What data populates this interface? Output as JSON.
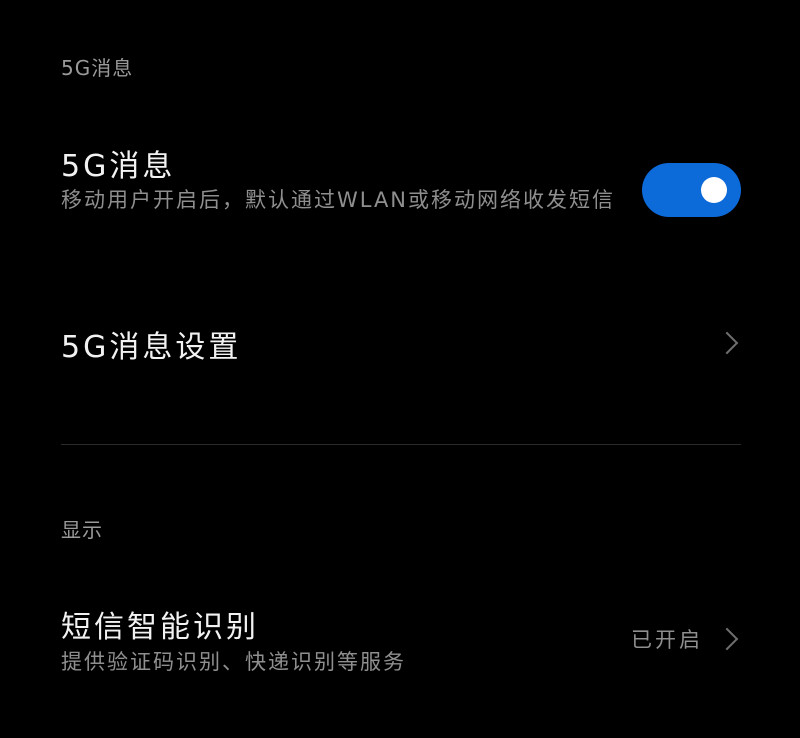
{
  "colors": {
    "background": "#000000",
    "accent": "#0d6ad9",
    "text_primary": "#f2f2f2",
    "text_secondary": "#8f8f8f"
  },
  "sections": [
    {
      "header": "5G消息",
      "items": [
        {
          "title": "5G消息",
          "description": "移动用户开启后，默认通过WLAN或移动网络收发短信",
          "control": "toggle",
          "toggle_on": true
        },
        {
          "title": "5G消息设置",
          "control": "chevron-right-icon"
        }
      ]
    },
    {
      "header": "显示",
      "items": [
        {
          "title": "短信智能识别",
          "description": "提供验证码识别、快递识别等服务",
          "status": "已开启",
          "control": "chevron-right-icon"
        }
      ]
    }
  ]
}
